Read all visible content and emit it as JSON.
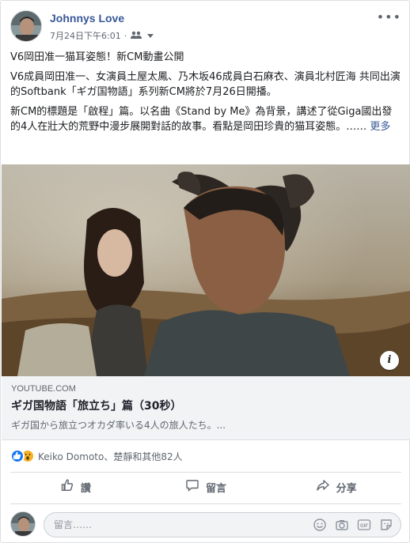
{
  "post": {
    "author": "Johnnys Love",
    "timestamp": "7月24日下午6:01",
    "title_line": "V6岡田准一猫耳姿態！新CM動畫公開",
    "para1": "V6成員岡田准一、女演員土屋太鳳、乃木坂46成員白石麻衣、演員北村匠海 共同出演的Softbank「ギガ国物語」系列新CM將於7月26日開播。",
    "para2": "新CM的標題是「啟程」篇。以名曲《Stand by Me》為背景，講述了從Giga國出發的4人在壯大的荒野中漫步展開對話的故事。看點是岡田珍貴的猫耳姿態。……",
    "see_more": "更多"
  },
  "link_preview": {
    "domain": "YOUTUBE.COM",
    "title": "ギガ国物語「旅立ち」篇（30秒）",
    "description": "ギガ国から旅立つオカダ率いる4人の旅人たち。..."
  },
  "reactions": {
    "text": "Keiko Domoto、楚靜和其他82人",
    "types": [
      "like",
      "wow"
    ]
  },
  "actions": {
    "like": "讚",
    "comment": "留言",
    "share": "分享"
  },
  "comment": {
    "placeholder": "留言……"
  },
  "colors": {
    "link_blue": "#385898",
    "like_blue": "#1877f2",
    "wow_yellow": "#f7b125",
    "grey_text": "#606770"
  },
  "icons": [
    "globe-friends-icon",
    "more-options-icon",
    "info-icon",
    "like-icon",
    "comment-icon",
    "share-icon",
    "emoji-icon",
    "camera-icon",
    "gif-icon",
    "sticker-icon"
  ]
}
